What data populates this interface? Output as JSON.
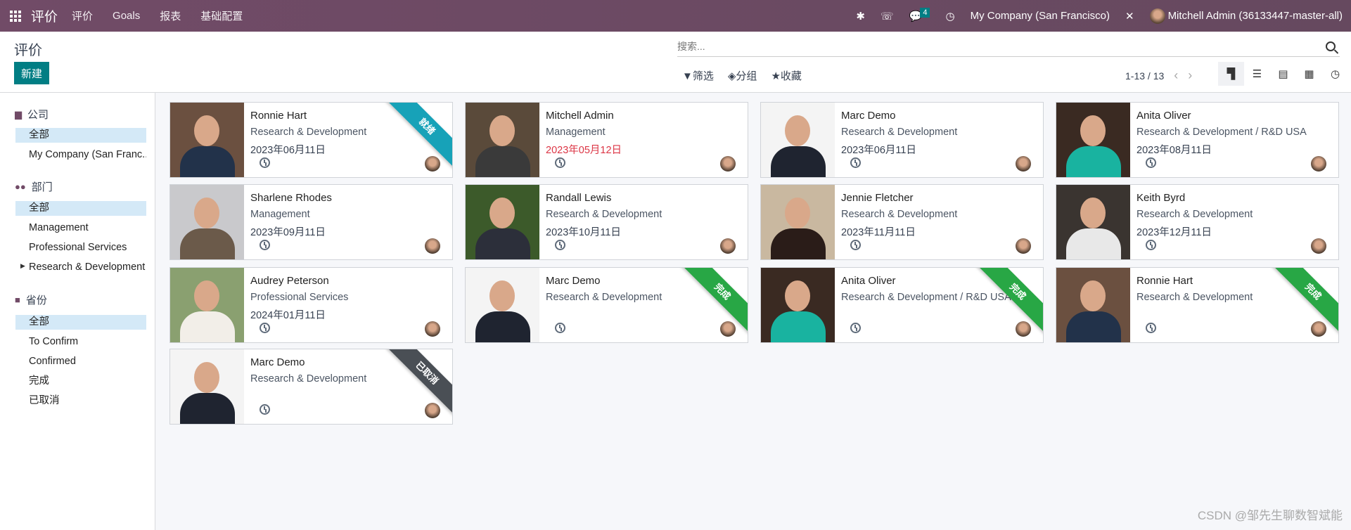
{
  "navbar": {
    "app_title": "评价",
    "menus": [
      "评价",
      "Goals",
      "报表",
      "基础配置"
    ],
    "chat_count": "4",
    "company": "My Company (San Francisco)",
    "user": "Mitchell Admin (36133447-master-all)"
  },
  "control_panel": {
    "title": "评价",
    "new_label": "新建",
    "search_placeholder": "搜索...",
    "filter_label": "筛选",
    "group_label": "分组",
    "favorite_label": "收藏",
    "pager": "1-13 / 13",
    "views": [
      "kanban",
      "list",
      "gantt",
      "calendar",
      "activity"
    ]
  },
  "sidebar": {
    "sections": [
      {
        "label": "公司",
        "icon": "building-icon",
        "items": [
          "全部",
          "My Company (San Franc..."
        ]
      },
      {
        "label": "部门",
        "icon": "users-icon",
        "items": [
          "全部",
          "Management",
          "Professional Services",
          "Research & Development"
        ]
      },
      {
        "label": "省份",
        "icon": "folder-icon",
        "items": [
          "全部",
          "To Confirm",
          "Confirmed",
          "完成",
          "已取消"
        ]
      }
    ]
  },
  "colors": {
    "navbar": "#714b67",
    "primary": "#017e84",
    "ready": "#17a2b8",
    "done": "#28a745",
    "cancelled": "#4a4f55",
    "overdue": "#dc3545"
  },
  "cards": [
    {
      "name": "Ronnie Hart",
      "dept": "Research & Development",
      "date": "2023年06月11日",
      "ribbon": "就绪",
      "ribbon_color": "#17a2b8",
      "bg": "#6b5040",
      "shirt": "#22324a"
    },
    {
      "name": "Mitchell Admin",
      "dept": "Management",
      "date": "2023年05月12日",
      "late": true,
      "bg": "#5a4a3a",
      "shirt": "#3a3a3a"
    },
    {
      "name": "Marc Demo",
      "dept": "Research & Development",
      "date": "2023年06月11日",
      "bg": "#f4f4f4",
      "shirt": "#1f2430"
    },
    {
      "name": "Anita Oliver",
      "dept": "Research & Development / R&D USA",
      "date": "2023年08月11日",
      "bg": "#3a2a22",
      "shirt": "#19b3a0"
    },
    {
      "name": "Sharlene Rhodes",
      "dept": "Management",
      "date": "2023年09月11日",
      "bg": "#c9c9cc",
      "shirt": "#6b5a4a"
    },
    {
      "name": "Randall Lewis",
      "dept": "Research & Development",
      "date": "2023年10月11日",
      "bg": "#3c5a2a",
      "shirt": "#2c2f3a"
    },
    {
      "name": "Jennie Fletcher",
      "dept": "Research & Development",
      "date": "2023年11月11日",
      "bg": "#c9b8a0",
      "shirt": "#2a1c18"
    },
    {
      "name": "Keith Byrd",
      "dept": "Research & Development",
      "date": "2023年12月11日",
      "bg": "#3a3430",
      "shirt": "#e8e8e8"
    },
    {
      "name": "Audrey Peterson",
      "dept": "Professional Services",
      "date": "2024年01月11日",
      "bg": "#8aa070",
      "shirt": "#f2eee8"
    },
    {
      "name": "Marc Demo",
      "dept": "Research & Development",
      "date": "",
      "ribbon": "完成",
      "ribbon_color": "#28a745",
      "bg": "#f4f4f4",
      "shirt": "#1f2430"
    },
    {
      "name": "Anita Oliver",
      "dept": "Research & Development / R&D USA",
      "date": "",
      "ribbon": "完成",
      "ribbon_color": "#28a745",
      "bg": "#3a2a22",
      "shirt": "#19b3a0"
    },
    {
      "name": "Ronnie Hart",
      "dept": "Research & Development",
      "date": "",
      "ribbon": "完成",
      "ribbon_color": "#28a745",
      "bg": "#6b5040",
      "shirt": "#22324a"
    },
    {
      "name": "Marc Demo",
      "dept": "Research & Development",
      "date": "",
      "ribbon": "已取消",
      "ribbon_color": "#4a4f55",
      "bg": "#f4f4f4",
      "shirt": "#1f2430"
    }
  ],
  "watermark": "CSDN @邹先生聊数智斌能"
}
